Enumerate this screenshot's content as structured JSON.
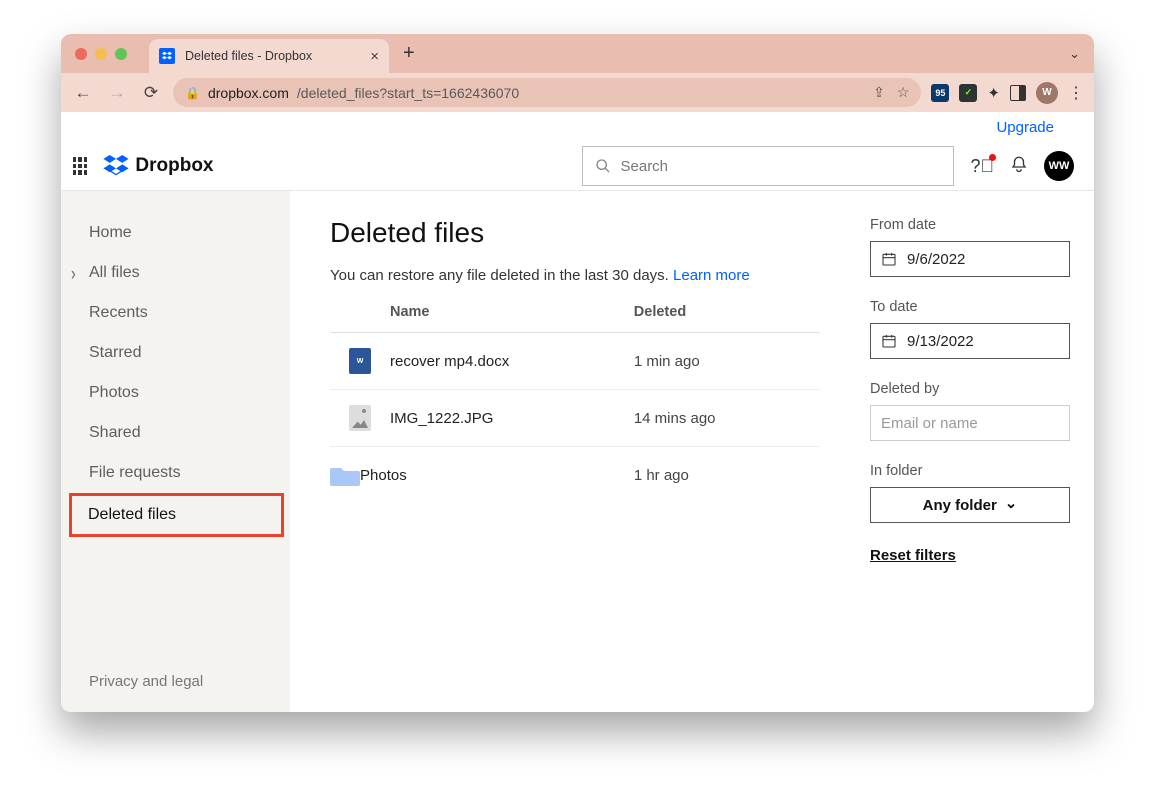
{
  "browser": {
    "tab_title": "Deleted files - Dropbox",
    "url_domain": "dropbox.com",
    "url_path": "/deleted_files?start_ts=1662436070",
    "avatar_letter": "W"
  },
  "header": {
    "upgrade": "Upgrade",
    "brand": "Dropbox",
    "search_placeholder": "Search",
    "avatar": "WW"
  },
  "sidebar": {
    "items": [
      {
        "label": "Home"
      },
      {
        "label": "All files"
      },
      {
        "label": "Recents"
      },
      {
        "label": "Starred"
      },
      {
        "label": "Photos"
      },
      {
        "label": "Shared"
      },
      {
        "label": "File requests"
      },
      {
        "label": "Deleted files"
      }
    ],
    "footer": "Privacy and legal"
  },
  "main": {
    "title": "Deleted files",
    "subtitle": "You can restore any file deleted in the last 30 days. ",
    "learn_more": "Learn more",
    "columns": {
      "name": "Name",
      "deleted": "Deleted"
    },
    "rows": [
      {
        "name": "recover mp4.docx",
        "time": "1 min ago",
        "type": "docx"
      },
      {
        "name": "IMG_1222.JPG",
        "time": "14 mins ago",
        "type": "jpg"
      },
      {
        "name": "Photos",
        "time": "1 hr ago",
        "type": "folder"
      }
    ]
  },
  "filters": {
    "from_label": "From date",
    "from_value": "9/6/2022",
    "to_label": "To date",
    "to_value": "9/13/2022",
    "deleted_by_label": "Deleted by",
    "deleted_by_placeholder": "Email or name",
    "folder_label": "In folder",
    "folder_value": "Any folder",
    "reset": "Reset filters"
  }
}
